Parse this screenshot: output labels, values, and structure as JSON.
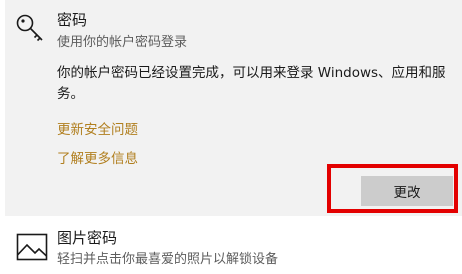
{
  "password_section": {
    "title": "密码",
    "subtitle": "使用你的帐户密码登录",
    "description": "你的帐户密码已经设置完成，可以用来登录 Windows、应用和服务。",
    "links": [
      "更新安全问题",
      "了解更多信息"
    ],
    "change_button": "更改",
    "icon": "key-icon"
  },
  "picture_password_section": {
    "title": "图片密码",
    "subtitle": "轻扫并点击你最喜爱的照片以解锁设备",
    "icon": "picture-icon"
  },
  "colors": {
    "panel_bg": "#f2f2f2",
    "link": "#b17f1f",
    "button_bg": "#cccccc",
    "highlight": "#e30000"
  }
}
